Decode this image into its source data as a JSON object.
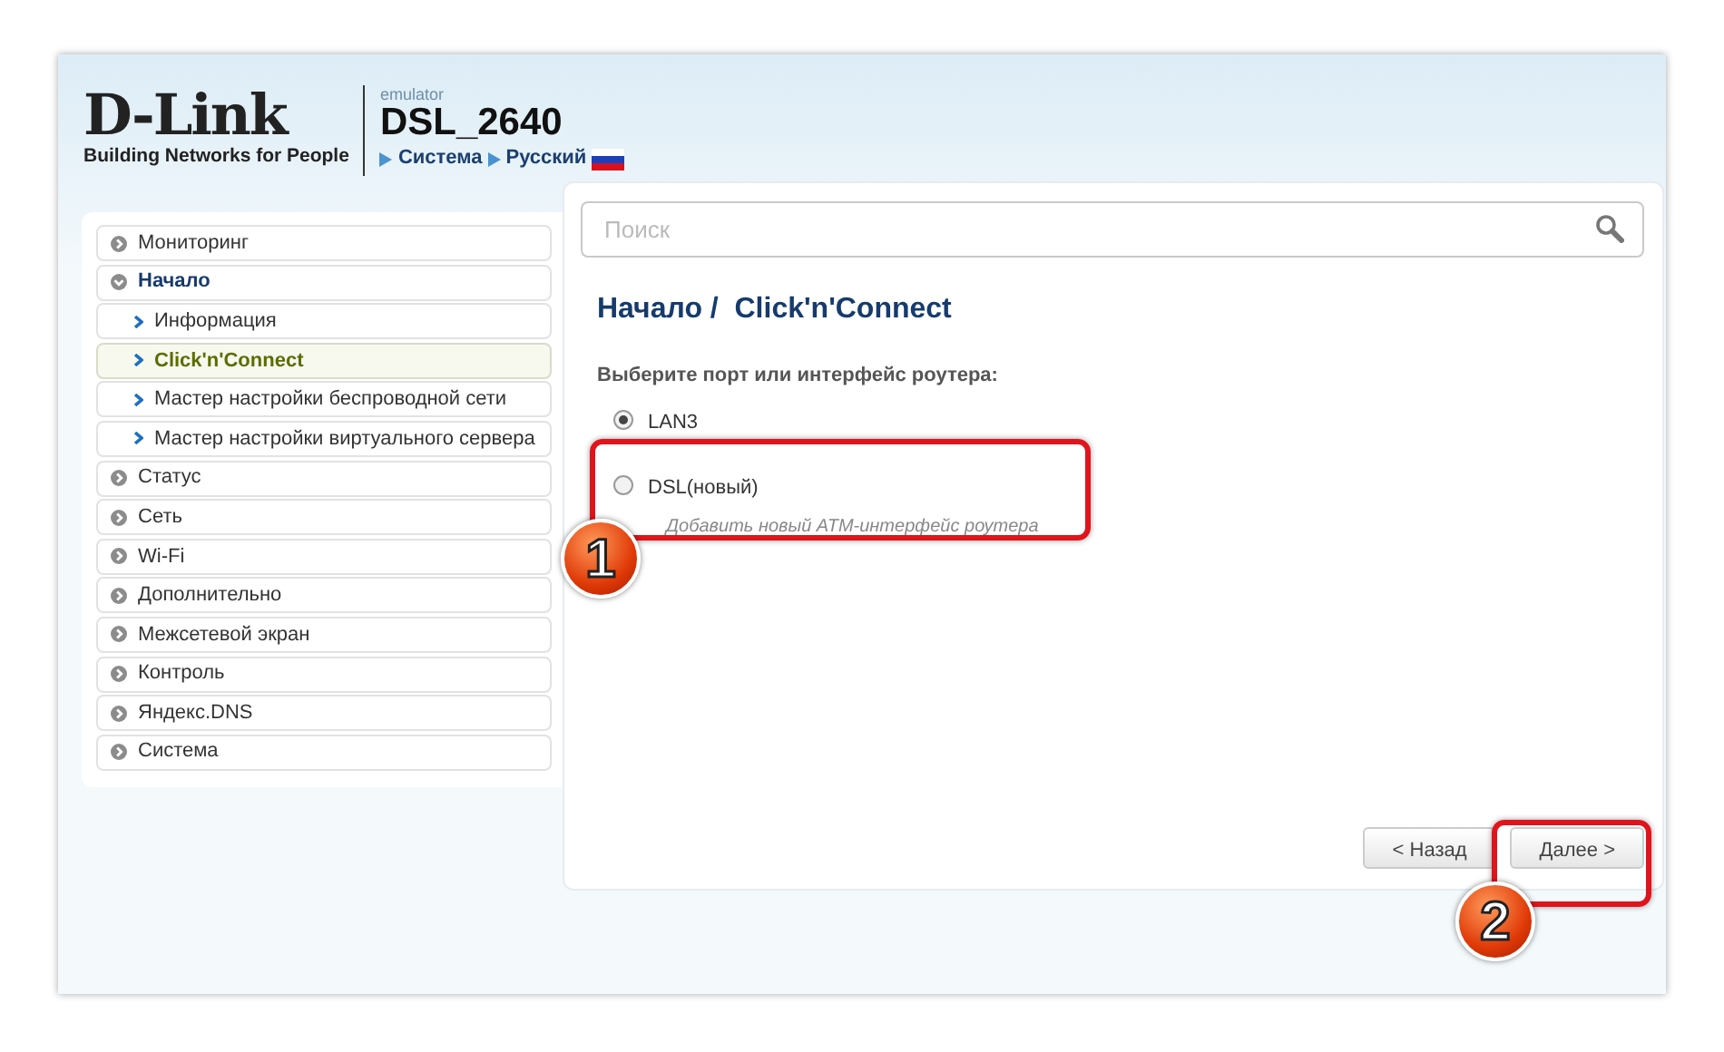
{
  "header": {
    "logo_title": "D-Link",
    "logo_tagline": "Building Networks for People",
    "subtitle": "emulator",
    "model": "DSL_2640",
    "breadcrumb": [
      "Система",
      "Русский"
    ]
  },
  "sidebar": {
    "items": [
      {
        "label": "Мониторинг",
        "expanded": false
      },
      {
        "label": "Начало",
        "expanded": true,
        "children": [
          {
            "label": "Информация",
            "selected": false
          },
          {
            "label": "Click'n'Connect",
            "selected": true
          },
          {
            "label": "Мастер настройки беспроводной сети",
            "selected": false
          },
          {
            "label": "Мастер настройки виртуального сервера",
            "selected": false
          }
        ]
      },
      {
        "label": "Статус",
        "expanded": false
      },
      {
        "label": "Сеть",
        "expanded": false
      },
      {
        "label": "Wi-Fi",
        "expanded": false
      },
      {
        "label": "Дополнительно",
        "expanded": false
      },
      {
        "label": "Межсетевой экран",
        "expanded": false
      },
      {
        "label": "Контроль",
        "expanded": false
      },
      {
        "label": "Яндекс.DNS",
        "expanded": false
      },
      {
        "label": "Система",
        "expanded": false
      }
    ]
  },
  "search": {
    "placeholder": "Поиск"
  },
  "page_title": "Начало /  Click'n'Connect",
  "prompt": "Выберите порт или интерфейс роутера:",
  "options": [
    {
      "label": "LAN3",
      "checked": true
    },
    {
      "label": "DSL(новый)",
      "description": "Добавить новый ATM-интерфейс роутера",
      "checked": false
    }
  ],
  "buttons": [
    "< Назад",
    "Далее >"
  ],
  "callouts": [
    "1",
    "2"
  ]
}
